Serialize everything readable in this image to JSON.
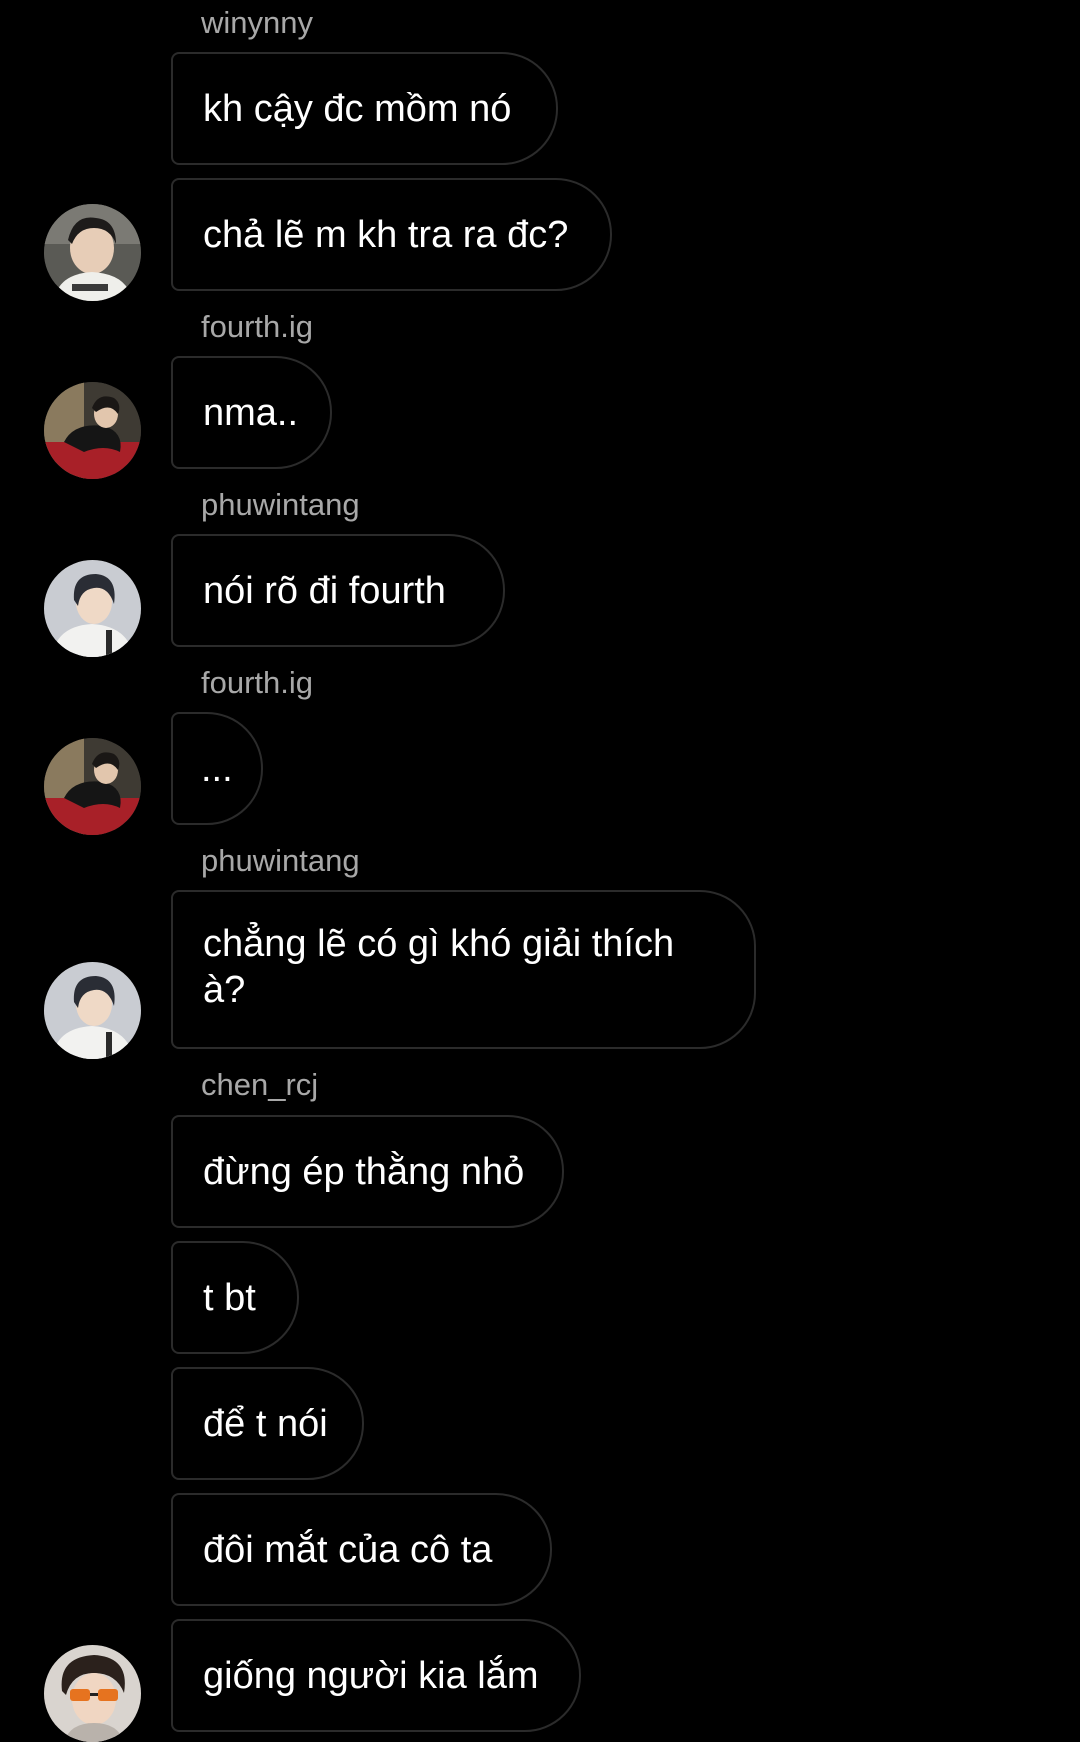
{
  "colors": {
    "background": "#000000",
    "bubble_border": "#2b2b2b",
    "sender_name": "#a8a8a8",
    "message_text": "#ffffff"
  },
  "messages": [
    {
      "sender": "winynny",
      "text": "kh cậy đc mồm nó"
    },
    {
      "text": "chả lẽ m kh tra ra đc?",
      "avatar": "avatar-winynny"
    },
    {
      "sender": "fourth.ig",
      "text": "nma..",
      "avatar": "avatar-fourth"
    },
    {
      "sender": "phuwintang",
      "text": "nói rõ đi fourth",
      "avatar": "avatar-phuwintang"
    },
    {
      "sender": "fourth.ig",
      "text": "...",
      "avatar": "avatar-fourth"
    },
    {
      "sender": "phuwintang",
      "text": "chẳng lẽ có gì khó giải thích\nà?",
      "avatar": "avatar-phuwintang"
    },
    {
      "sender": "chen_rcj",
      "text": "đừng ép thằng nhỏ"
    },
    {
      "text": "t bt"
    },
    {
      "text": "để t nói"
    },
    {
      "text": "đôi mắt của cô ta"
    },
    {
      "text": "giống người kia lắm",
      "avatar": "avatar-chen"
    }
  ]
}
